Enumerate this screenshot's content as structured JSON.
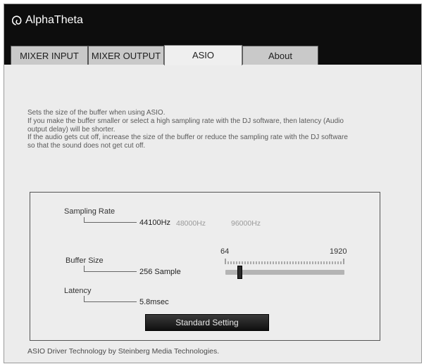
{
  "app": {
    "logo_text": "AlphaTheta"
  },
  "tabs": [
    {
      "label": "MIXER INPUT",
      "active": false
    },
    {
      "label": "MIXER OUTPUT",
      "active": false
    },
    {
      "label": "ASIO",
      "active": true
    },
    {
      "label": "About",
      "active": false
    }
  ],
  "description": {
    "lines": [
      "Sets the size of the buffer when using ASIO.",
      "If you make the buffer smaller or select a high sampling rate with the DJ software, then latency (Audio",
      "output delay) will be shorter.",
      "If the audio gets cut off, increase the size of the buffer or reduce the sampling rate with the DJ software",
      "so that the sound does not get cut off."
    ]
  },
  "sampling_rate": {
    "label": "Sampling Rate",
    "options": [
      "44100Hz",
      "48000Hz",
      "96000Hz"
    ],
    "selected": "44100Hz"
  },
  "buffer_size": {
    "label": "Buffer Size",
    "value": "256 Sample",
    "slider_min_label": "64",
    "slider_max_label": "1920",
    "slider_fraction": 0.105
  },
  "latency": {
    "label": "Latency",
    "value": "5.8msec"
  },
  "standard_button": "Standard Setting",
  "footer": "ASIO Driver Technology by Steinberg Media Technologies.",
  "colors": {
    "header_bg": "#0d0d0d",
    "tab_inactive": "#c9c9c9",
    "tab_active": "#efefef",
    "panel_bg": "#ededed"
  },
  "icons": {
    "logo": "alphatheta-swirl-icon"
  }
}
